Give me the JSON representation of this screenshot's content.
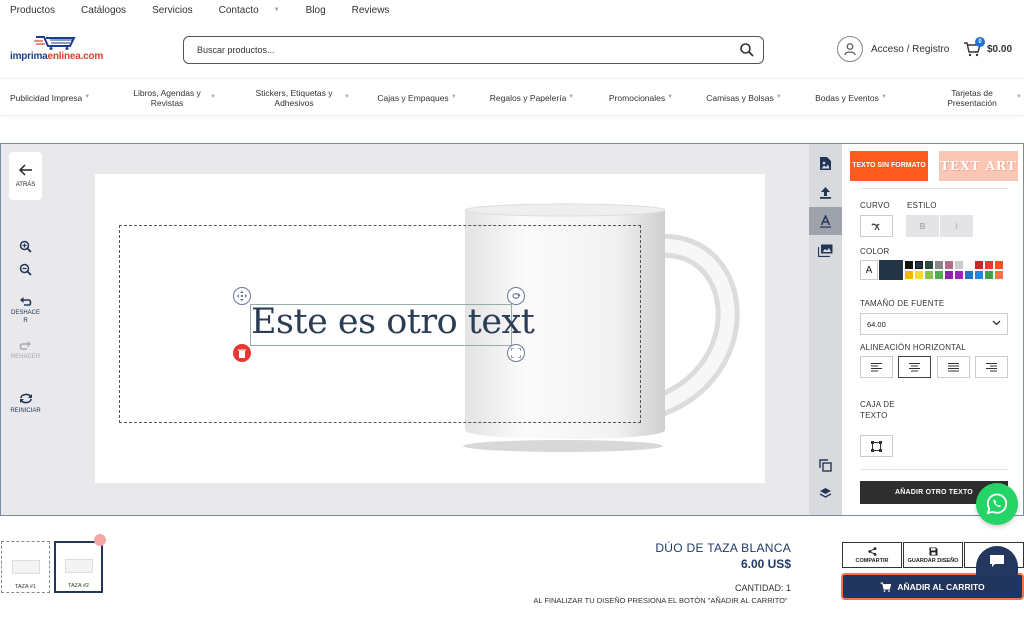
{
  "toplinks": {
    "items": [
      {
        "label": "Productos"
      },
      {
        "label": "Catálogos"
      },
      {
        "label": "Servicios"
      },
      {
        "label": "Contacto"
      },
      {
        "label": "Blog"
      },
      {
        "label": "Reviews"
      }
    ]
  },
  "header": {
    "logo_blue": "imprima",
    "logo_red": "enlinea",
    "logo_suffix": ".com",
    "search_placeholder": "Buscar productos...",
    "account_label": "Acceso / Registro",
    "cart_count": "0",
    "cart_total": "$0.00"
  },
  "catnav": {
    "items": [
      {
        "label": "Publicidad Impresa"
      },
      {
        "label": "Libros, Agendas y Revistas"
      },
      {
        "label": "Stickers, Etiquetas y Adhesivos"
      },
      {
        "label": "Cajas y Empaques"
      },
      {
        "label": "Regalos y Papelería"
      },
      {
        "label": "Promocionales"
      },
      {
        "label": "Camisas y Bolsas"
      },
      {
        "label": "Bodas y Eventos"
      },
      {
        "label": "Tarjetas de Presentación"
      }
    ]
  },
  "designer": {
    "back_label": "ATRÁS",
    "undo_label": "DESHACER",
    "redo_label": "REHACER",
    "reset_label": "REINICIAR",
    "canvas_text": "Este es otro text",
    "panel": {
      "plain_text_button": "TEXTO SIN FORMATO",
      "text_art_button": "TEXT ART",
      "curve_label": "CURVO",
      "style_label": "ESTILO",
      "bold_label": "B",
      "italic_label": "I",
      "color_label": "COLOR",
      "color_a": "A",
      "font_size_label": "TAMAÑO DE FUENTE",
      "font_size_value": "64.00",
      "align_label": "ALINEACIÓN HORIZONTAL",
      "textbox_label": "CAJA DE TEXTO",
      "add_text_button": "AÑADIR OTRO TEXTO",
      "selected_color": "#243447",
      "swatches": [
        "#111111",
        "#243447",
        "#2e4a3e",
        "#888888",
        "#b36d8a",
        "#cccccc",
        "#ffffff",
        "#c62828",
        "#e53935",
        "#f4511e",
        "#f5b700",
        "#fdd835",
        "#8bc34a",
        "#4caf50",
        "#8e24aa",
        "#9c27b0",
        "#1976d2",
        "#1e88e5",
        "#43a047",
        "#ff7043"
      ]
    }
  },
  "thumbs": [
    {
      "label": "TAZA #1"
    },
    {
      "label": "TAZA #2"
    }
  ],
  "product": {
    "title": "DÚO DE TAZA BLANCA",
    "price": "6.00 US$",
    "quantity": "CANTIDAD: 1",
    "note": "AL FINALIZAR TU DISEÑO PRESIONA EL BOTÓN \"AÑADIR AL CARRITO\"",
    "share_label": "COMPARTIR",
    "save_label": "GUARDAR DISEÑO",
    "add_to_cart": "AÑADIR AL CARRITO"
  },
  "colors": {
    "accent_orange": "#ff5a1f",
    "navy": "#22355c",
    "whatsapp": "#25d366"
  }
}
